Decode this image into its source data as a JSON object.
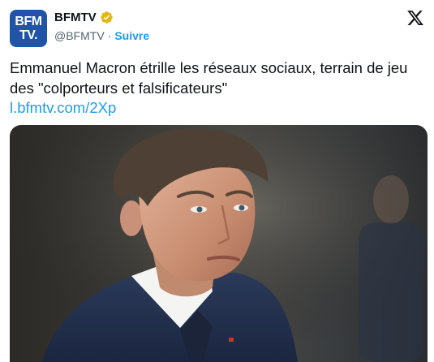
{
  "account": {
    "avatar_line1": "BFM",
    "avatar_line2": "TV.",
    "name": "BFMTV",
    "handle": "@BFMTV",
    "separator": "·",
    "follow_label": "Suivre",
    "verified_icon": "verified-badge-gold"
  },
  "tweet": {
    "text": "Emmanuel Macron étrille les réseaux sociaux, terrain de jeu des \"colporteurs et falsificateurs\"",
    "link": "l.bfmtv.com/2Xp"
  },
  "colors": {
    "brand_blue": "#1f54a6",
    "link_blue": "#1d9bf0",
    "verified_gold": "#e2b719",
    "muted_text": "#536471"
  },
  "icons": {
    "top_right": "x-logo-icon"
  }
}
